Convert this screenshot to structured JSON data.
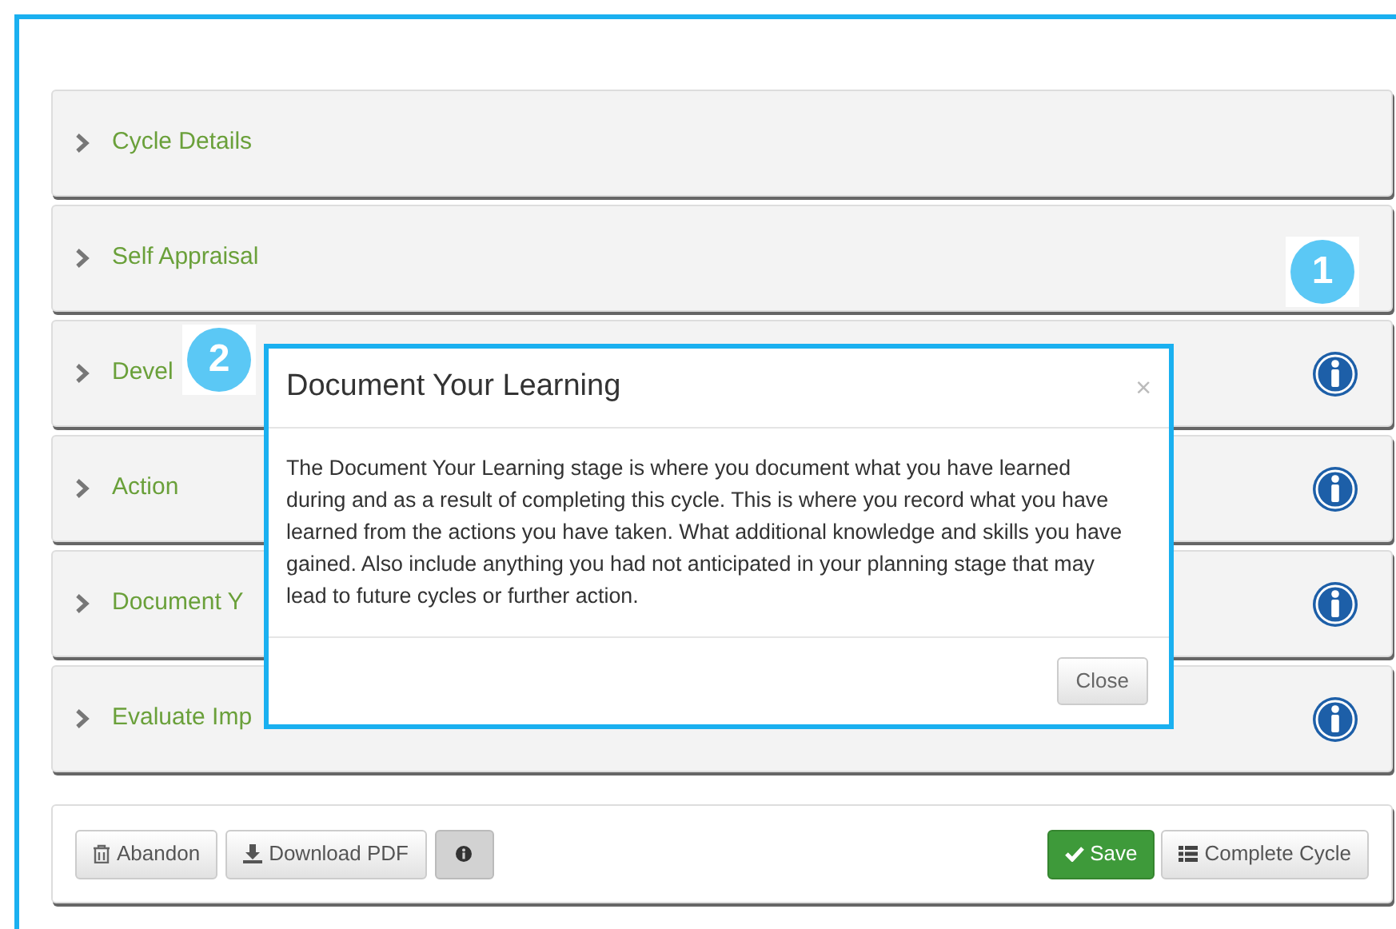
{
  "panels": [
    {
      "title": "Cycle Details",
      "info": false
    },
    {
      "title": "Self Appraisal",
      "info": false,
      "callout": "1"
    },
    {
      "title": "Devel",
      "info": true
    },
    {
      "title": "Action",
      "info": true
    },
    {
      "title": "Document Y",
      "info": true
    },
    {
      "title": "Evaluate Imp",
      "info": true
    }
  ],
  "footer": {
    "left": [
      {
        "kind": "abandon",
        "label": "Abandon"
      },
      {
        "kind": "download",
        "label": "Download PDF"
      },
      {
        "kind": "info"
      }
    ],
    "right": [
      {
        "kind": "save",
        "label": "Save"
      },
      {
        "kind": "complete",
        "label": "Complete Cycle"
      }
    ]
  },
  "modal": {
    "title": "Document Your Learning",
    "close_symbol": "×",
    "body": "The Document Your Learning stage is where you document what you have learned during and as a result of completing this cycle. This is where you record what you have learned from the actions you have taken. What additional knowledge and skills you have gained. Also include anything you had not anticipated in your planning stage that may lead to future cycles or further action.",
    "button": "Close"
  },
  "callouts": [
    {
      "number": "2"
    }
  ]
}
